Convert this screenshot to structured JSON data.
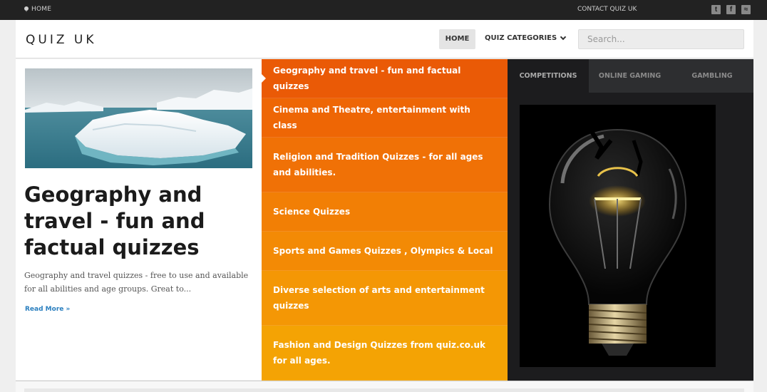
{
  "topbar": {
    "home_label": "HOME",
    "contact_label": "CONTACT QUIZ UK",
    "social": {
      "twitter": "t",
      "facebook": "f",
      "rss": "≈"
    }
  },
  "header": {
    "logo": "QUIZ UK",
    "nav": {
      "home": "HOME",
      "categories": "QUIZ CATEGORIES"
    },
    "search_placeholder": "Search..."
  },
  "featured": {
    "title": "Geography and travel - fun and factual quizzes",
    "excerpt": "Geography and travel quizzes - free to use and available for all abilities and age groups. Great to...",
    "read_more": "Read More »"
  },
  "categories": [
    {
      "label": "Geography and travel - fun and factual quizzes",
      "color": "#ea5a06"
    },
    {
      "label": "Cinema and Theatre, entertainment with class",
      "color": "#ee6605"
    },
    {
      "label": "Religion and Tradition Quizzes - for all ages and abilities.",
      "color": "#f07106"
    },
    {
      "label": "Science Quizzes",
      "color": "#f27f05"
    },
    {
      "label": "Sports and Games Quizzes , Olympics & Local",
      "color": "#f38a05"
    },
    {
      "label": "Diverse selection of arts and entertainment quizzes",
      "color": "#f49705"
    },
    {
      "label": "Fashion and Design Quizzes from quiz.co.uk for all ages.",
      "color": "#f4a304"
    }
  ],
  "tabs": {
    "competitions": "COMPETITIONS",
    "online_gaming": "ONLINE GAMING",
    "gambling": "GAMBLING"
  },
  "colors": {
    "topbar": "#222222",
    "dark_panel": "#1c1c1e",
    "link": "#2a7fbf"
  }
}
